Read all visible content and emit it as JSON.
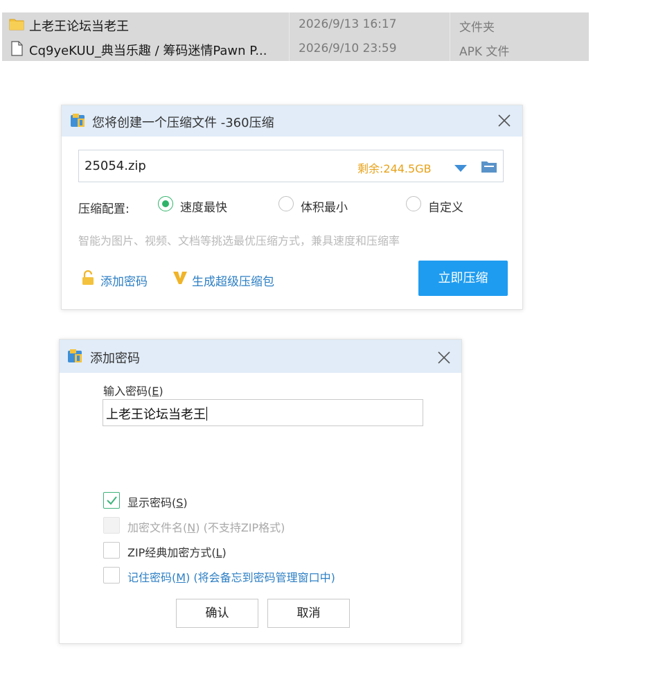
{
  "files": [
    {
      "icon": "folder-icon",
      "name": "上老王论坛当老王",
      "date": "2026/9/13 16:17",
      "type": "文件夹"
    },
    {
      "icon": "file-icon",
      "name": "Cq9yeKUU_典当乐趣 / 筹码迷情Pawn P...",
      "date": "2026/9/10 23:59",
      "type": "APK 文件"
    }
  ],
  "compress_dialog": {
    "title": "您将创建一个压缩文件 -360压缩",
    "filename": "25054.zip",
    "space_left": "剩余:244.5GB",
    "config_label": "压缩配置:",
    "options": [
      {
        "label": "速度最快",
        "checked": true
      },
      {
        "label": "体积最小",
        "checked": false
      },
      {
        "label": "自定义",
        "checked": false
      }
    ],
    "hint": "智能为图片、视频、文档等挑选最优压缩方式，兼具速度和压缩率",
    "add_password": "添加密码",
    "super_package": "生成超级压缩包",
    "compress_now": "立即压缩"
  },
  "password_dialog": {
    "title": "添加密码",
    "input_label": "输入密码",
    "input_label_key": "E",
    "password": "上老王论坛当老王",
    "checkboxes": [
      {
        "label": "显示密码",
        "key": "S",
        "suffix": "",
        "checked": true,
        "enabled": true
      },
      {
        "label": "加密文件名",
        "key": "N",
        "suffix": " (不支持ZIP格式)",
        "checked": false,
        "enabled": false
      },
      {
        "label": "ZIP经典加密方式",
        "key": "L",
        "suffix": "",
        "checked": false,
        "enabled": true
      },
      {
        "label": "记住密码",
        "key": "M",
        "suffix": " (将会备忘到密码管理窗口中)",
        "checked": false,
        "enabled": true
      }
    ],
    "ok": "确认",
    "cancel": "取消"
  },
  "colors": {
    "accent": "#1e9cf0",
    "radio_green": "#2fb36a",
    "link_blue": "#2d7fc4",
    "space_orange": "#e8a21a",
    "title_bg": "#e1ecf8"
  }
}
